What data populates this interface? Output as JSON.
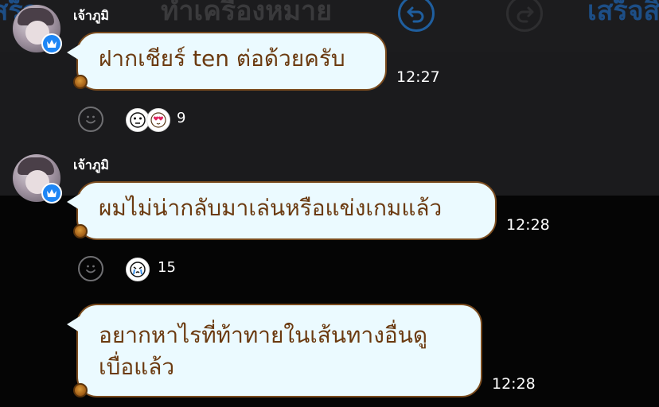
{
  "toolbar": {
    "left_label": "เสร็จ",
    "title": "ทำเครื่องหมาย",
    "undo_icon": "undo-icon",
    "redo_icon": "redo-icon",
    "done_label": "เสร็จสิ้น"
  },
  "messages": [
    {
      "sender": "เจ้าภูมิ",
      "text": "ฝากเชียร์ ten ต่อด้วยครับ",
      "time": "12:27",
      "reaction_count": "9",
      "reaction_icons": [
        "bear-cry-sticker-icon",
        "heart-eyes-sticker-icon"
      ]
    },
    {
      "sender": "เจ้าภูมิ",
      "text": "ผมไม่น่ากลับมาเล่นหรือแข่งเกมแล้ว",
      "time": "12:28",
      "reaction_count": "15",
      "reaction_icons": [
        "crying-face-sticker-icon"
      ]
    },
    {
      "text_line1": "อยากหาไรที่ท้าทายในเส้นทางอื่นดู",
      "text_line2": "เบื่อแล้ว",
      "time": "12:28"
    }
  ],
  "colors": {
    "bubble_bg": "#ebfaff",
    "bubble_border": "#7a4b1e",
    "bubble_text": "#6b3a10",
    "badge_blue": "#1e86f5",
    "background": "#050505"
  }
}
